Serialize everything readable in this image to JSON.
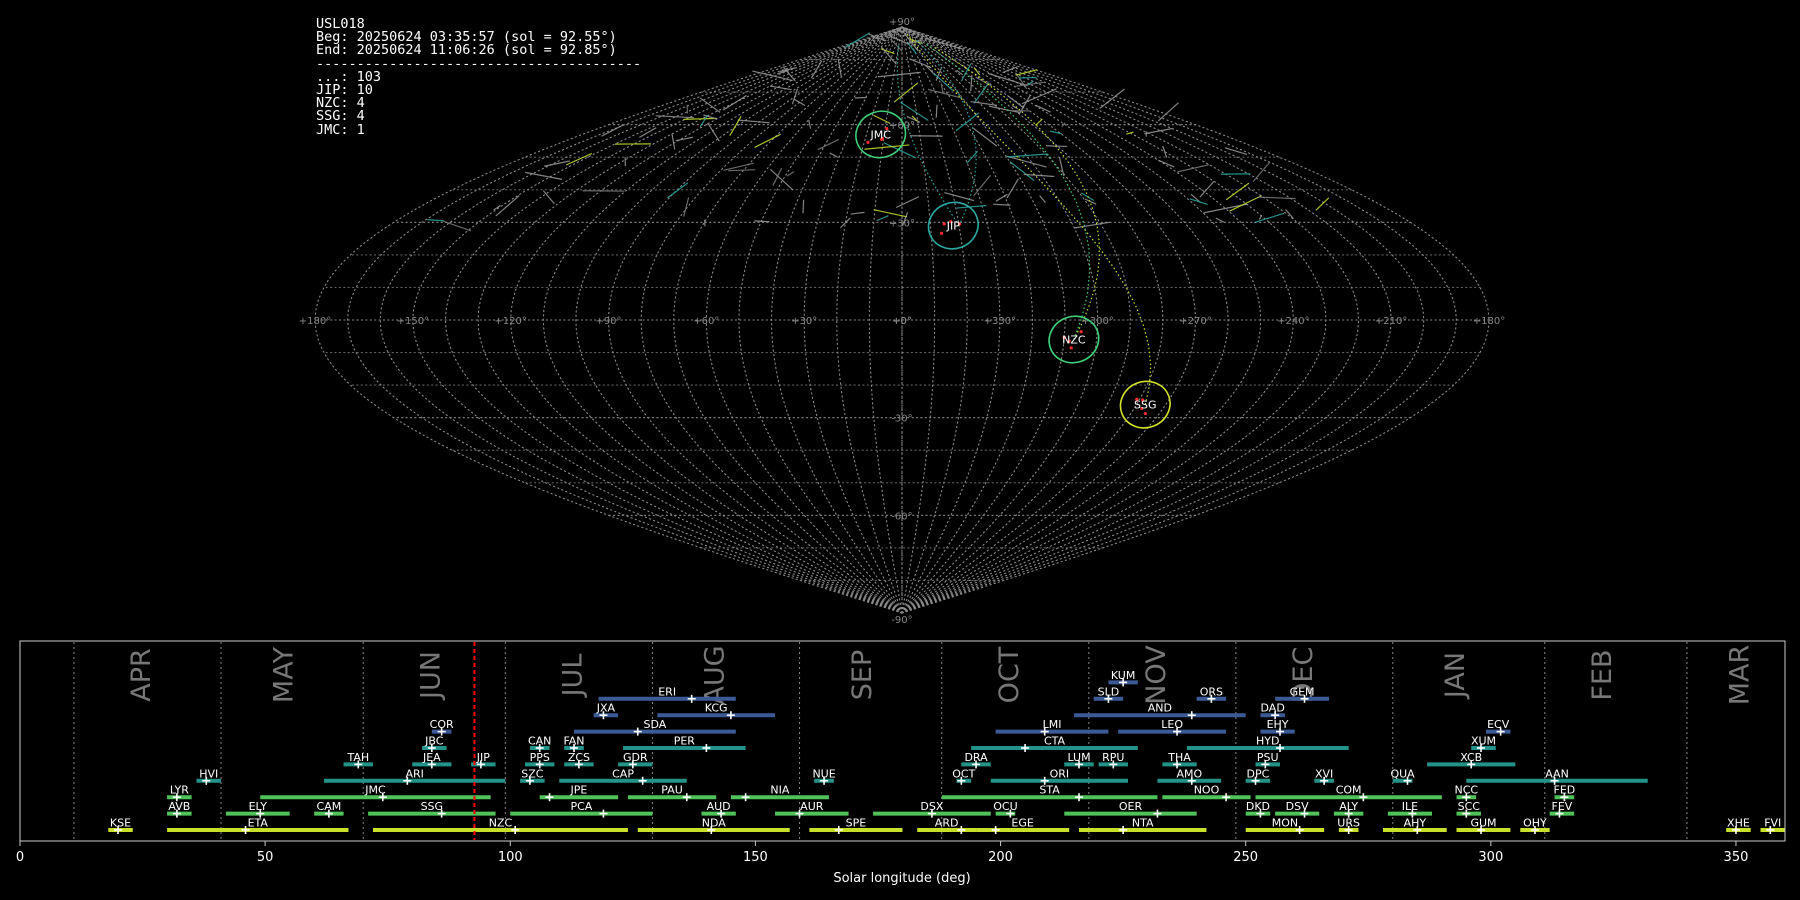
{
  "header": {
    "station": "USL018",
    "begin": "Beg: 20250624 03:35:57 (sol = 92.55°)",
    "end": "End: 20250624 11:06:26 (sol = 92.85°)",
    "separator": "----------------------------------------",
    "counts": [
      {
        "code": "...",
        "count": 103
      },
      {
        "code": "JIP",
        "count": 10
      },
      {
        "code": "NZC",
        "count": 4
      },
      {
        "code": "SSG",
        "count": 4
      },
      {
        "code": "JMC",
        "count": 1
      }
    ]
  },
  "colors": {
    "background": "#000000",
    "grid": "#8a8a8a",
    "marker": "#ff2a2a",
    "sol_line": "#ff0000",
    "circle_green": "#3fd07a",
    "circle_teal": "#2aa8a0",
    "circle_yellow": "#d4e22a",
    "bar_yellow": "#c8e02a",
    "bar_green": "#4fc25a",
    "bar_teal": "#23938a",
    "bar_blue": "#3b5a96"
  },
  "sky_map": {
    "projection": "sinusoidal",
    "lon_labels": [
      "+180°",
      "+150°",
      "+120°",
      "+90°",
      "+60°",
      "+30°",
      "+0°",
      "+330°",
      "+300°",
      "+270°",
      "+240°",
      "+210°",
      "+180°"
    ],
    "lat_labels": [
      "+90°",
      "+60°",
      "+30°",
      "+0°",
      "-30°",
      "-60°",
      "-90°"
    ],
    "radiants": [
      {
        "name": "JMC",
        "lon": 12,
        "lat": 57,
        "color": "circle_green"
      },
      {
        "name": "JIP",
        "lon": 342,
        "lat": 29,
        "color": "circle_teal"
      },
      {
        "name": "NZC",
        "lon": 307,
        "lat": -6,
        "color": "circle_green"
      },
      {
        "name": "SSG",
        "lon": 277,
        "lat": -26,
        "color": "circle_yellow"
      }
    ]
  },
  "chart_data": {
    "type": "timeline",
    "xlabel": "Solar longitude (deg)",
    "xlim": [
      0,
      360
    ],
    "xticks": [
      0,
      50,
      100,
      150,
      200,
      250,
      300,
      350
    ],
    "current_sol": 92.7,
    "months": [
      {
        "name": "APR",
        "center": 25,
        "start": 11
      },
      {
        "name": "MAY",
        "center": 54,
        "start": 41
      },
      {
        "name": "JUN",
        "center": 84,
        "start": 70
      },
      {
        "name": "JUL",
        "center": 113,
        "start": 99
      },
      {
        "name": "AUG",
        "center": 142,
        "start": 129
      },
      {
        "name": "SEP",
        "center": 172,
        "start": 159
      },
      {
        "name": "OCT",
        "center": 202,
        "start": 188
      },
      {
        "name": "NOV",
        "center": 232,
        "start": 218
      },
      {
        "name": "DEC",
        "center": 262,
        "start": 248
      },
      {
        "name": "JAN",
        "center": 293,
        "start": 280
      },
      {
        "name": "FEB",
        "center": 323,
        "start": 311
      },
      {
        "name": "MAR",
        "center": 351,
        "start": 340
      }
    ],
    "showers": [
      {
        "name": "KUM",
        "start": 222,
        "end": 228,
        "peak": 225,
        "row": 10,
        "color": "bar_blue"
      },
      {
        "name": "ERI",
        "start": 118,
        "end": 146,
        "peak": 137,
        "row": 9,
        "color": "bar_blue"
      },
      {
        "name": "SLD",
        "start": 219,
        "end": 225,
        "peak": 222,
        "row": 9,
        "color": "bar_blue"
      },
      {
        "name": "ORS",
        "start": 240,
        "end": 246,
        "peak": 243,
        "row": 9,
        "color": "bar_blue"
      },
      {
        "name": "GEM",
        "start": 256,
        "end": 267,
        "peak": 262,
        "row": 9,
        "color": "bar_blue"
      },
      {
        "name": "JXA",
        "start": 117,
        "end": 122,
        "peak": 119,
        "row": 8,
        "color": "bar_blue"
      },
      {
        "name": "KCG",
        "start": 130,
        "end": 154,
        "peak": 145,
        "row": 8,
        "color": "bar_blue"
      },
      {
        "name": "AND",
        "start": 215,
        "end": 250,
        "peak": 239,
        "row": 8,
        "color": "bar_blue"
      },
      {
        "name": "DAD",
        "start": 253,
        "end": 258,
        "peak": 256,
        "row": 8,
        "color": "bar_blue"
      },
      {
        "name": "COR",
        "start": 84,
        "end": 88,
        "peak": 86,
        "row": 7,
        "color": "bar_blue"
      },
      {
        "name": "SDA",
        "start": 113,
        "end": 146,
        "peak": 126,
        "row": 7,
        "color": "bar_blue"
      },
      {
        "name": "LMI",
        "start": 199,
        "end": 222,
        "peak": 209,
        "row": 7,
        "color": "bar_blue"
      },
      {
        "name": "LEO",
        "start": 224,
        "end": 246,
        "peak": 236,
        "row": 7,
        "color": "bar_blue"
      },
      {
        "name": "EHY",
        "start": 253,
        "end": 260,
        "peak": 257,
        "row": 7,
        "color": "bar_blue"
      },
      {
        "name": "ECV",
        "start": 299,
        "end": 304,
        "peak": 302,
        "row": 7,
        "color": "bar_blue"
      },
      {
        "name": "JBC",
        "start": 82,
        "end": 87,
        "peak": 84,
        "row": 6,
        "color": "bar_teal"
      },
      {
        "name": "CAN",
        "start": 104,
        "end": 108,
        "peak": 106,
        "row": 6,
        "color": "bar_teal"
      },
      {
        "name": "FAN",
        "start": 111,
        "end": 115,
        "peak": 113,
        "row": 6,
        "color": "bar_teal"
      },
      {
        "name": "PER",
        "start": 123,
        "end": 148,
        "peak": 140,
        "row": 6,
        "color": "bar_teal"
      },
      {
        "name": "CTA",
        "start": 194,
        "end": 228,
        "peak": 205,
        "row": 6,
        "color": "bar_teal"
      },
      {
        "name": "HYD",
        "start": 238,
        "end": 271,
        "peak": 257,
        "row": 6,
        "color": "bar_teal"
      },
      {
        "name": "XUM",
        "start": 296,
        "end": 301,
        "peak": 298,
        "row": 6,
        "color": "bar_teal"
      },
      {
        "name": "TAH",
        "start": 66,
        "end": 72,
        "peak": 69,
        "row": 5,
        "color": "bar_teal"
      },
      {
        "name": "JEA",
        "start": 80,
        "end": 88,
        "peak": 84,
        "row": 5,
        "color": "bar_teal"
      },
      {
        "name": "JIP",
        "start": 92,
        "end": 97,
        "peak": 94,
        "row": 5,
        "color": "bar_teal"
      },
      {
        "name": "PPS",
        "start": 103,
        "end": 109,
        "peak": 106,
        "row": 5,
        "color": "bar_teal"
      },
      {
        "name": "ZCS",
        "start": 111,
        "end": 117,
        "peak": 114,
        "row": 5,
        "color": "bar_teal"
      },
      {
        "name": "GDR",
        "start": 122,
        "end": 129,
        "peak": 125,
        "row": 5,
        "color": "bar_teal"
      },
      {
        "name": "DRA",
        "start": 192,
        "end": 198,
        "peak": 195,
        "row": 5,
        "color": "bar_teal"
      },
      {
        "name": "LUM",
        "start": 213,
        "end": 219,
        "peak": 216,
        "row": 5,
        "color": "bar_teal"
      },
      {
        "name": "RPU",
        "start": 220,
        "end": 226,
        "peak": 223,
        "row": 5,
        "color": "bar_teal"
      },
      {
        "name": "THA",
        "start": 233,
        "end": 240,
        "peak": 236,
        "row": 5,
        "color": "bar_teal"
      },
      {
        "name": "PSU",
        "start": 252,
        "end": 257,
        "peak": 254,
        "row": 5,
        "color": "bar_teal"
      },
      {
        "name": "XCB",
        "start": 287,
        "end": 305,
        "peak": 296,
        "row": 5,
        "color": "bar_teal"
      },
      {
        "name": "HVI",
        "start": 36,
        "end": 41,
        "peak": 38,
        "row": 4,
        "color": "bar_teal"
      },
      {
        "name": "ARI",
        "start": 62,
        "end": 99,
        "peak": 79,
        "row": 4,
        "color": "bar_teal"
      },
      {
        "name": "SZC",
        "start": 102,
        "end": 107,
        "peak": 104,
        "row": 4,
        "color": "bar_teal"
      },
      {
        "name": "CAP",
        "start": 110,
        "end": 136,
        "peak": 127,
        "row": 4,
        "color": "bar_teal"
      },
      {
        "name": "NUE",
        "start": 162,
        "end": 166,
        "peak": 164,
        "row": 4,
        "color": "bar_teal"
      },
      {
        "name": "OCT",
        "start": 191,
        "end": 194,
        "peak": 192,
        "row": 4,
        "color": "bar_teal"
      },
      {
        "name": "ORI",
        "start": 198,
        "end": 226,
        "peak": 209,
        "row": 4,
        "color": "bar_teal"
      },
      {
        "name": "AMO",
        "start": 232,
        "end": 245,
        "peak": 239,
        "row": 4,
        "color": "bar_teal"
      },
      {
        "name": "DPC",
        "start": 250,
        "end": 255,
        "peak": 252,
        "row": 4,
        "color": "bar_teal"
      },
      {
        "name": "XVI",
        "start": 264,
        "end": 268,
        "peak": 266,
        "row": 4,
        "color": "bar_teal"
      },
      {
        "name": "QUA",
        "start": 280,
        "end": 284,
        "peak": 283,
        "row": 4,
        "color": "bar_teal"
      },
      {
        "name": "AAN",
        "start": 295,
        "end": 332,
        "peak": 313,
        "row": 4,
        "color": "bar_teal"
      },
      {
        "name": "LYR",
        "start": 30,
        "end": 35,
        "peak": 32,
        "row": 3,
        "color": "bar_green"
      },
      {
        "name": "JMC",
        "start": 49,
        "end": 96,
        "peak": 74,
        "row": 3,
        "color": "bar_green"
      },
      {
        "name": "JPE",
        "start": 106,
        "end": 122,
        "peak": 108,
        "row": 3,
        "color": "bar_green"
      },
      {
        "name": "PAU",
        "start": 124,
        "end": 142,
        "peak": 136,
        "row": 3,
        "color": "bar_green"
      },
      {
        "name": "NIA",
        "start": 145,
        "end": 165,
        "peak": 148,
        "row": 3,
        "color": "bar_green"
      },
      {
        "name": "STA",
        "start": 188,
        "end": 232,
        "peak": 216,
        "row": 3,
        "color": "bar_green"
      },
      {
        "name": "NOO",
        "start": 233,
        "end": 251,
        "peak": 246,
        "row": 3,
        "color": "bar_green"
      },
      {
        "name": "COM",
        "start": 252,
        "end": 290,
        "peak": 274,
        "row": 3,
        "color": "bar_green"
      },
      {
        "name": "NCC",
        "start": 293,
        "end": 297,
        "peak": 295,
        "row": 3,
        "color": "bar_green"
      },
      {
        "name": "FED",
        "start": 313,
        "end": 317,
        "peak": 315,
        "row": 3,
        "color": "bar_green"
      },
      {
        "name": "AVB",
        "start": 30,
        "end": 35,
        "peak": 32,
        "row": 2,
        "color": "bar_green"
      },
      {
        "name": "ELY",
        "start": 42,
        "end": 55,
        "peak": 49,
        "row": 2,
        "color": "bar_green"
      },
      {
        "name": "CAM",
        "start": 60,
        "end": 66,
        "peak": 63,
        "row": 2,
        "color": "bar_green"
      },
      {
        "name": "SSG",
        "start": 71,
        "end": 97,
        "peak": 86,
        "row": 2,
        "color": "bar_green"
      },
      {
        "name": "PCA",
        "start": 100,
        "end": 129,
        "peak": 119,
        "row": 2,
        "color": "bar_green"
      },
      {
        "name": "AUD",
        "start": 139,
        "end": 146,
        "peak": 143,
        "row": 2,
        "color": "bar_green"
      },
      {
        "name": "AUR",
        "start": 154,
        "end": 169,
        "peak": 159,
        "row": 2,
        "color": "bar_green"
      },
      {
        "name": "DSX",
        "start": 174,
        "end": 198,
        "peak": 186,
        "row": 2,
        "color": "bar_green"
      },
      {
        "name": "OCU",
        "start": 199,
        "end": 203,
        "peak": 202,
        "row": 2,
        "color": "bar_green"
      },
      {
        "name": "OER",
        "start": 213,
        "end": 240,
        "peak": 232,
        "row": 2,
        "color": "bar_green"
      },
      {
        "name": "DKD",
        "start": 250,
        "end": 255,
        "peak": 253,
        "row": 2,
        "color": "bar_green"
      },
      {
        "name": "DSV",
        "start": 256,
        "end": 265,
        "peak": 262,
        "row": 2,
        "color": "bar_green"
      },
      {
        "name": "ALY",
        "start": 268,
        "end": 274,
        "peak": 271,
        "row": 2,
        "color": "bar_green"
      },
      {
        "name": "ILE",
        "start": 279,
        "end": 288,
        "peak": 284,
        "row": 2,
        "color": "bar_green"
      },
      {
        "name": "SCC",
        "start": 293,
        "end": 298,
        "peak": 295,
        "row": 2,
        "color": "bar_green"
      },
      {
        "name": "FEV",
        "start": 312,
        "end": 317,
        "peak": 314,
        "row": 2,
        "color": "bar_green"
      },
      {
        "name": "KSE",
        "start": 18,
        "end": 23,
        "peak": 20,
        "row": 1,
        "color": "bar_yellow"
      },
      {
        "name": "ETA",
        "start": 30,
        "end": 67,
        "peak": 46,
        "row": 1,
        "color": "bar_yellow"
      },
      {
        "name": "NZC",
        "start": 72,
        "end": 124,
        "peak": 101,
        "row": 1,
        "color": "bar_yellow"
      },
      {
        "name": "NDA",
        "start": 126,
        "end": 157,
        "peak": 141,
        "row": 1,
        "color": "bar_yellow"
      },
      {
        "name": "SPE",
        "start": 161,
        "end": 180,
        "peak": 167,
        "row": 1,
        "color": "bar_yellow"
      },
      {
        "name": "ARD",
        "start": 183,
        "end": 195,
        "peak": 192,
        "row": 1,
        "color": "bar_yellow"
      },
      {
        "name": "EGE",
        "start": 195,
        "end": 214,
        "peak": 199,
        "row": 1,
        "color": "bar_yellow"
      },
      {
        "name": "NTA",
        "start": 216,
        "end": 242,
        "peak": 225,
        "row": 1,
        "color": "bar_yellow"
      },
      {
        "name": "MON",
        "start": 250,
        "end": 266,
        "peak": 261,
        "row": 1,
        "color": "bar_yellow"
      },
      {
        "name": "URS",
        "start": 269,
        "end": 273,
        "peak": 271,
        "row": 1,
        "color": "bar_yellow"
      },
      {
        "name": "AHY",
        "start": 278,
        "end": 291,
        "peak": 285,
        "row": 1,
        "color": "bar_yellow"
      },
      {
        "name": "GUM",
        "start": 293,
        "end": 304,
        "peak": 298,
        "row": 1,
        "color": "bar_yellow"
      },
      {
        "name": "OHY",
        "start": 306,
        "end": 312,
        "peak": 309,
        "row": 1,
        "color": "bar_yellow"
      },
      {
        "name": "XHE",
        "start": 348,
        "end": 353,
        "peak": 350,
        "row": 1,
        "color": "bar_yellow"
      },
      {
        "name": "FVI",
        "start": 355,
        "end": 360,
        "peak": 357,
        "row": 1,
        "color": "bar_yellow"
      }
    ]
  }
}
